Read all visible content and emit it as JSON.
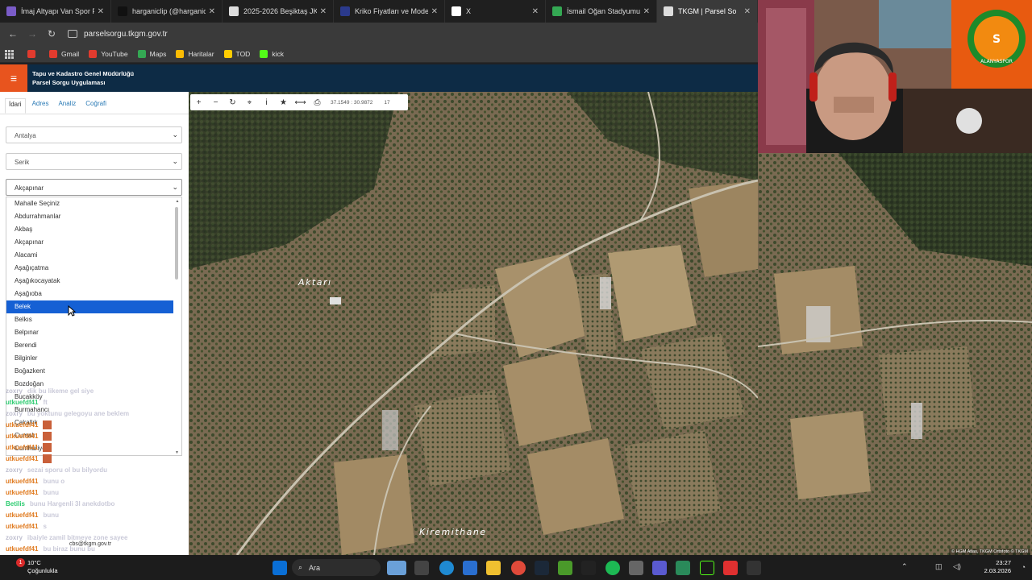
{
  "browser": {
    "tabs": [
      {
        "label": "İmaj Altyapı Van Spor FK",
        "icon": "page-icon",
        "color": "#7a5cc8"
      },
      {
        "label": "harganiclip (@harganiclip)",
        "icon": "tiktok-icon",
        "color": "#111111"
      },
      {
        "label": "2025-2026 Beşiktaş JK M...",
        "icon": "globe-icon",
        "color": "#dddddd"
      },
      {
        "label": "Kriko Fiyatları ve Modeller",
        "icon": "page-icon",
        "color": "#2b3a8c"
      },
      {
        "label": "X",
        "icon": "x-icon",
        "color": "#ffffff"
      },
      {
        "label": "İsmail Oğan Stadyumu - G",
        "icon": "maps-pin-icon",
        "color": "#34a853"
      },
      {
        "label": "TKGM | Parsel So",
        "icon": "globe-icon",
        "color": "#dddddd"
      }
    ],
    "url": "parselsorgu.tkgm.gov.tr",
    "bookmarks": [
      {
        "label": "",
        "color": "#e23b2e"
      },
      {
        "label": "Gmail",
        "color": "#e23b2e"
      },
      {
        "label": "YouTube",
        "color": "#e23b2e"
      },
      {
        "label": "Maps",
        "color": "#34a853"
      },
      {
        "label": "Haritalar",
        "color": "#fbbc04"
      },
      {
        "label": "TOD",
        "color": "#ffcc00"
      },
      {
        "label": "kick",
        "color": "#53fc18"
      }
    ]
  },
  "app": {
    "title_line1": "Tapu ve Kadastro Genel Müdürlüğü",
    "title_line2": "Parsel Sorgu Uygulaması",
    "accent": "#e8541e",
    "header_bg": "#0d2b45"
  },
  "sidebar": {
    "tabs": [
      "İdari",
      "Adres",
      "Analiz",
      "Coğrafi"
    ],
    "active_tab": "İdari",
    "province": "Antalya",
    "district": "Serik",
    "neighborhood": "Akçapınar",
    "options": [
      "Mahalle Seçiniz",
      "Abdurrahmanlar",
      "Akbaş",
      "Akçapınar",
      "Alacami",
      "Aşağıçatma",
      "Aşağıkocayatak",
      "Aşağıoba",
      "Belek",
      "Belkıs",
      "Belpınar",
      "Berendi",
      "Bilginler",
      "Boğazkent",
      "Bozdoğan",
      "Bucakköy",
      "Burmahancı",
      "Çakallık",
      "Cumalı",
      "Cumhuriyet"
    ],
    "selected_option": "Belek"
  },
  "map": {
    "toolbar_coords": "37.1549 : 30.9872",
    "zoom_level": "17",
    "labels": {
      "village1": "Aktarı",
      "village2": "Kiremithane"
    },
    "attribution": "© HGM Atlas, TKGM Ortofoto © TKGM"
  },
  "chat": [
    {
      "name": "zoxry",
      "color": "#c0c0d0",
      "msg": "dik bu likeme gel siye"
    },
    {
      "name": "utkuefdf41",
      "color": "#2ecc71",
      "msg": "ft"
    },
    {
      "name": "zoxry",
      "color": "#c0c0d0",
      "msg": "bu yoktunu gelegoyu ane beklem"
    },
    {
      "name": "utkuefdf41",
      "color": "#e07a1f",
      "msg": ""
    },
    {
      "name": "utkuefdf41",
      "color": "#e07a1f",
      "msg": ""
    },
    {
      "name": "utkuefdf41",
      "color": "#e07a1f",
      "msg": ""
    },
    {
      "name": "utkuefdf41",
      "color": "#e07a1f",
      "msg": ""
    },
    {
      "name": "zoxry",
      "color": "#c0c0d0",
      "msg": "sezai sporu ol bu bilyordu"
    },
    {
      "name": "utkuefdf41",
      "color": "#e07a1f",
      "msg": "bunu o"
    },
    {
      "name": "utkuefdf41",
      "color": "#e07a1f",
      "msg": "bunu"
    },
    {
      "name": "Betilis",
      "color": "#2ecc71",
      "msg": "bunu Hargenli 3l anekdotbo"
    },
    {
      "name": "utkuefdf41",
      "color": "#e07a1f",
      "msg": "bunu"
    },
    {
      "name": "utkuefdf41",
      "color": "#e07a1f",
      "msg": "s"
    },
    {
      "name": "zoxry",
      "color": "#c0c0d0",
      "msg": "ibaiyle zamil bitmeye zone sayee"
    },
    {
      "name": "utkuefdf41",
      "color": "#e07a1f",
      "msg": "bu biraz bunu bu"
    }
  ],
  "chat_footer": "cbs@tkgm.gov.tr",
  "taskbar": {
    "weather_temp": "10°C",
    "weather_desc": "Çoğunlukla",
    "search_placeholder": "Ara",
    "time": "23:27",
    "date": "2.03.2026",
    "notification_count": "1"
  }
}
